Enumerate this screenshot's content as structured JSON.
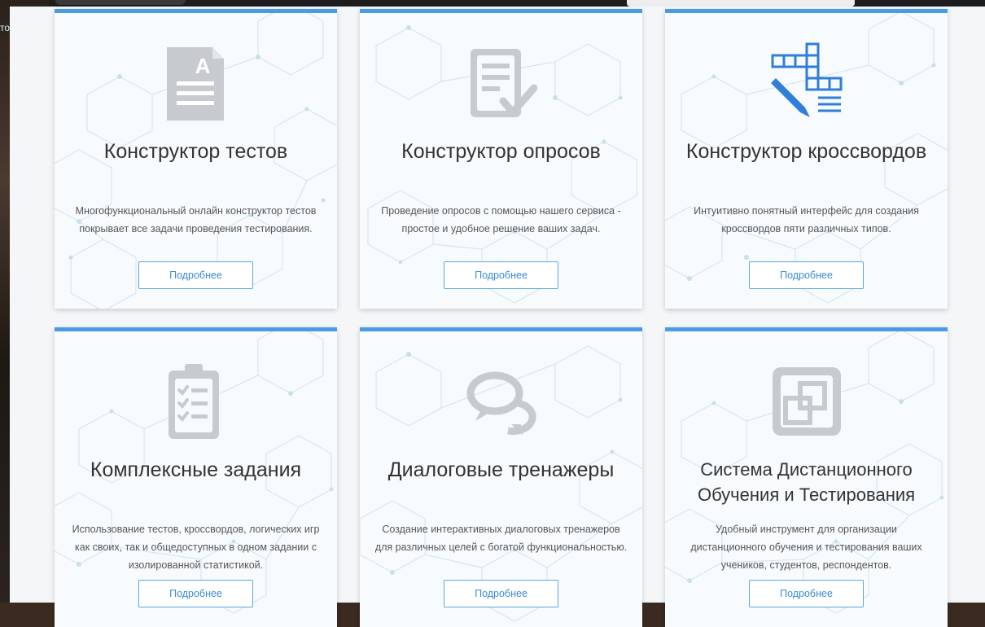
{
  "background": {
    "left_fragment": "то"
  },
  "colors": {
    "accent": "#4b9ae4",
    "icon_gray": "#c7cbd0",
    "icon_blue": "#2f7ed8",
    "button_text": "#3a8ad2"
  },
  "cards": [
    {
      "icon": "document-letter-a-icon",
      "title": "Конструктор тестов",
      "description": "Многофункциональный онлайн конструктор тестов покрывает все задачи проведения тестирования.",
      "button": "Подробнее"
    },
    {
      "icon": "survey-checklist-icon",
      "title": "Конструктор опросов",
      "description": "Проведение опросов с помощью нашего сервиса - простое и удобное решение ваших задач.",
      "button": "Подробнее"
    },
    {
      "icon": "crossword-pencil-icon",
      "title": "Конструктор кроссвордов",
      "description": "Интуитивно понятный интерфейс для создания кроссвордов пяти различных типов.",
      "button": "Подробнее"
    },
    {
      "icon": "clipboard-checklist-icon",
      "title": "Комплексные задания",
      "description": "Использование тестов, кроссвордов, логических игр как своих, так и общедоступных в одном задании с изолированной статистикой.",
      "button": "Подробнее"
    },
    {
      "icon": "speech-bubbles-icon",
      "title": "Диалоговые тренажеры",
      "description": "Создание интерактивных диалоговых тренажеров для различных целей с богатой функциональностью.",
      "button": "Подробнее"
    },
    {
      "icon": "window-squares-icon",
      "title": "Система Дистанционного Обучения и Тестирования",
      "description": "Удобный инструмент для организации дистанционного обучения и тестирования ваших учеников, студентов, респондентов.",
      "button": "Подробнее"
    }
  ]
}
